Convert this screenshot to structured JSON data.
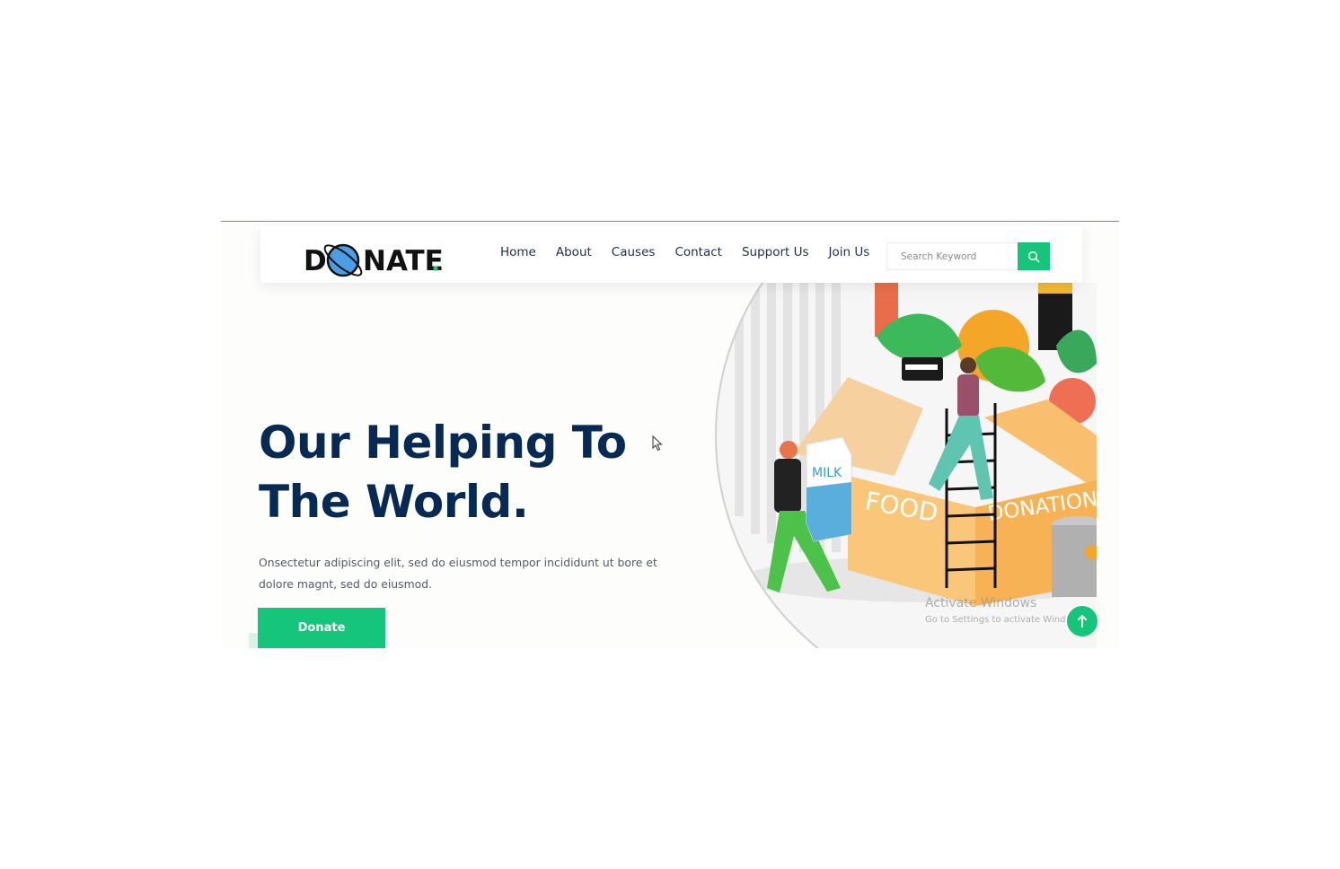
{
  "brand": {
    "logo_text_left": "D",
    "logo_text_right": "NATE",
    "logo_dot_color": "#15c57c"
  },
  "nav": {
    "items": [
      {
        "label": "Home"
      },
      {
        "label": "About"
      },
      {
        "label": "Causes"
      },
      {
        "label": "Contact"
      },
      {
        "label": "Support Us"
      },
      {
        "label": "Join Us"
      }
    ]
  },
  "search": {
    "placeholder": "Search Keyword",
    "icon": "search-icon"
  },
  "hero": {
    "title_line1": "Our Helping To",
    "title_line2": "The World.",
    "text": "Onsectetur adipiscing elit, sed do eiusmod tempor incididunt ut bore et dolore magnt, sed do eiusmod.",
    "button_label": "Donate"
  },
  "illustration": {
    "box_left_label": "FOOD",
    "box_right_label": "DONATION",
    "carton_label": "MILK"
  },
  "watermark": {
    "line1": "Activate Windows",
    "line2": "Go to Settings to activate Windows."
  },
  "colors": {
    "accent": "#15c57c",
    "heading": "#062a54",
    "nav_text": "#1f2d4d"
  }
}
